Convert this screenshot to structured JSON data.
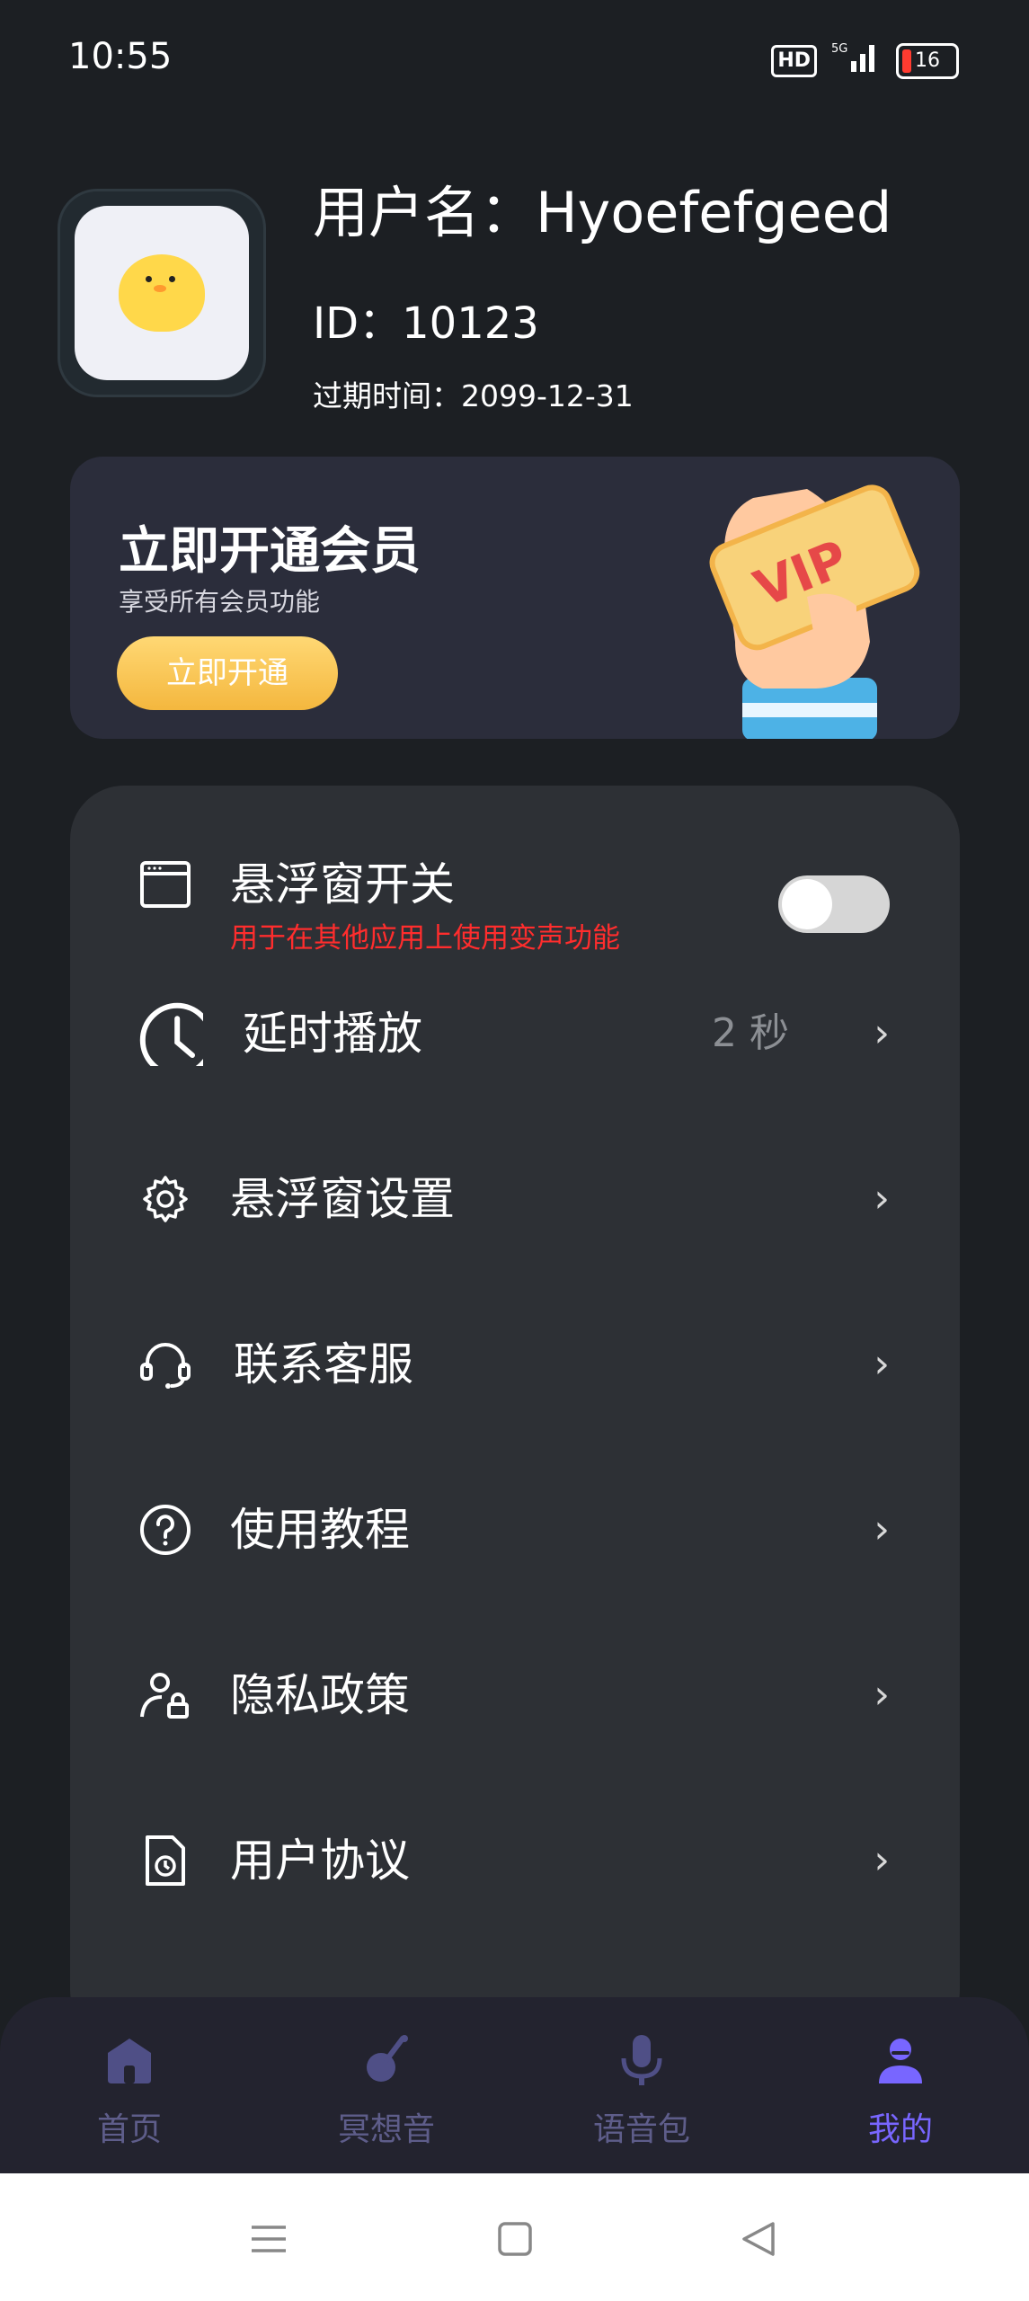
{
  "status_bar": {
    "time": "10:55",
    "hd": "HD",
    "signal": "5G",
    "battery": "16"
  },
  "profile": {
    "username": "用户名：Hyoefefgeed",
    "id": "ID：10123",
    "expire": "过期时间：2099-12-31"
  },
  "vip_card": {
    "title": "立即开通会员",
    "subtitle": "享受所有会员功能",
    "button": "立即开通",
    "badge": "VIP"
  },
  "settings": {
    "float_switch": {
      "label": "悬浮窗开关",
      "hint": "用于在其他应用上使用变声功能",
      "on": false
    },
    "delay": {
      "label": "延时播放",
      "value": "2 秒"
    },
    "float_settings": {
      "label": "悬浮窗设置"
    },
    "contact": {
      "label": "联系客服"
    },
    "tutorial": {
      "label": "使用教程"
    },
    "privacy": {
      "label": "隐私政策"
    },
    "agreement": {
      "label": "用户协议"
    }
  },
  "tabbar": {
    "tabs": [
      {
        "label": "首页",
        "icon": "home-icon"
      },
      {
        "label": "冥想音",
        "icon": "meditation-icon"
      },
      {
        "label": "语音包",
        "icon": "microphone-icon"
      },
      {
        "label": "我的",
        "icon": "profile-icon",
        "active": true
      }
    ],
    "inactive_color": "#5e5d8a",
    "active_color": "#7866ff"
  }
}
